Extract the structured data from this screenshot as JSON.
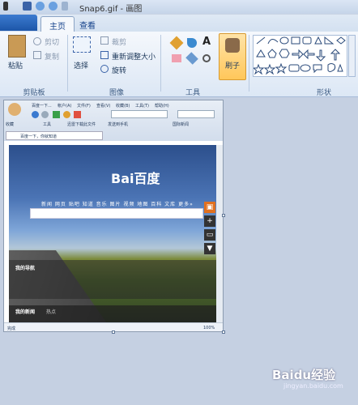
{
  "window": {
    "title": "Snap6.gif - 画图"
  },
  "tabs": [
    {
      "label": "主页"
    },
    {
      "label": "查看"
    }
  ],
  "clipboard": {
    "paste": "粘贴",
    "cut": "剪切",
    "copy": "复制",
    "group": "剪贴板"
  },
  "image": {
    "select": "选择",
    "crop": "裁剪",
    "resize": "重新调整大小",
    "rotate": "旋转",
    "group": "图像"
  },
  "tools": {
    "group": "工具",
    "brush": "刷子"
  },
  "shapes": {
    "group": "形状"
  },
  "browser": {
    "tab1": "百度一下...",
    "menu": [
      "帐户(A)",
      "文件(F)",
      "查看(V)",
      "收藏(B)",
      "工具(T)",
      "帮助(H)"
    ],
    "favorites": [
      "收藏",
      "工具",
      "迅雷下载此文件",
      "发送到手机",
      "国际新闻"
    ],
    "tab_title": "百度一下，你就知道",
    "logo": "Bai百度",
    "nav": "新闻 网页 贴吧 知道 音乐 图片 视频 地图 百科 文库 更多»",
    "my_nav": "我的导航",
    "my_news": "我的新闻",
    "hot": "热点",
    "status": "完成",
    "zoom": "100%"
  },
  "watermark": {
    "text": "Baidu经验",
    "sub": "jingyan.baidu.com"
  }
}
